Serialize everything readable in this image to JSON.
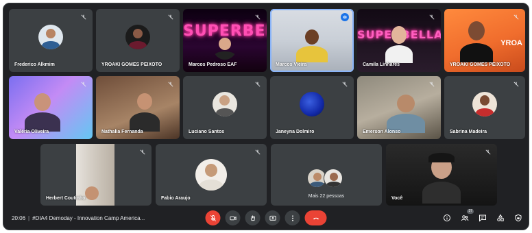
{
  "participants": [
    {
      "name": "Frederico Alkmim",
      "mic": "muted"
    },
    {
      "name": "YROAKI GOMES PEIXOTO",
      "mic": "muted"
    },
    {
      "name": "Marcos Pedroso EAF",
      "mic": "muted",
      "overlay": "SUPERBELLA"
    },
    {
      "name": "Marcos Vieira",
      "mic": "active"
    },
    {
      "name": "Camila Linhares",
      "mic": "muted",
      "overlay": "SUPERBELLA"
    },
    {
      "name": "YROAKI GOMES PEIXOTO",
      "mic": "muted",
      "overlay": "YROA"
    },
    {
      "name": "Valéria Oliveira",
      "mic": "muted"
    },
    {
      "name": "Nathalia Fernanda",
      "mic": "muted"
    },
    {
      "name": "Luciano Santos",
      "mic": "muted"
    },
    {
      "name": "Janeyna Dolmiro",
      "mic": "muted"
    },
    {
      "name": "Emerson Alonso",
      "mic": "muted"
    },
    {
      "name": "Sabrina Madeira",
      "mic": "muted"
    },
    {
      "name": "Herbert Coutinho",
      "mic": "muted"
    },
    {
      "name": "Fabio Araujo",
      "mic": "muted"
    },
    {
      "name": "Você",
      "mic": "muted"
    }
  ],
  "more_people": {
    "label": "Mais 22 pessoas"
  },
  "bottom_bar": {
    "time": "20:06",
    "separator": "|",
    "meeting_title": "#DIA4 Demoday - Innovation Camp America...",
    "participant_count": "37"
  },
  "icons": {
    "mic": "mic-off-icon",
    "camera": "camera-icon",
    "hand": "raise-hand-icon",
    "present": "present-screen-icon",
    "more": "more-vert-icon",
    "hangup": "hangup-icon",
    "info": "info-icon",
    "people": "people-icon",
    "chat": "chat-icon",
    "activities": "activities-icon",
    "lock": "host-controls-icon"
  },
  "colors": {
    "background": "#202124",
    "tile": "#3c4043",
    "danger": "#ea4335",
    "accent": "#1a73e8"
  }
}
